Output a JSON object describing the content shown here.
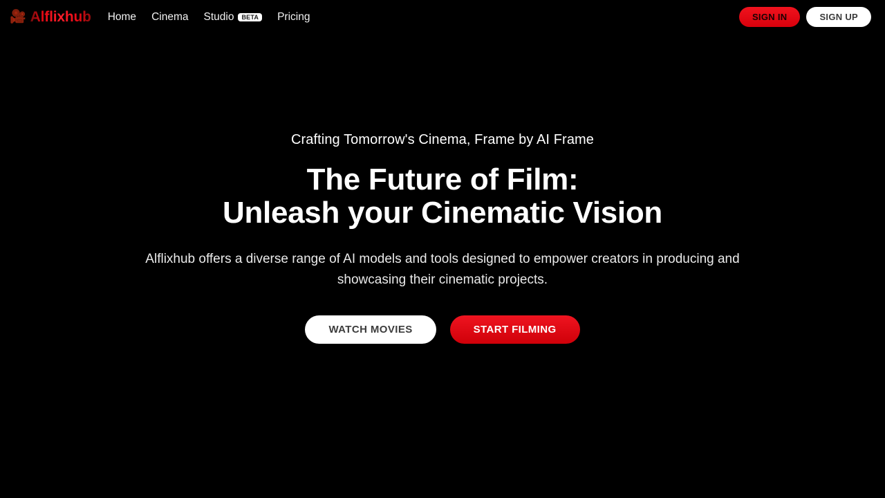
{
  "theme": {
    "background": "#000000",
    "brand_red": "#e60914",
    "text_primary": "#ffffff",
    "text_on_light": "#3c3c3c"
  },
  "header": {
    "brand": {
      "icon": "movie-camera-icon",
      "icon_glyph": "🎥",
      "name": "Alflixhub"
    },
    "nav": [
      {
        "label": "Home",
        "badge": null
      },
      {
        "label": "Cinema",
        "badge": null
      },
      {
        "label": "Studio",
        "badge": "BETA"
      },
      {
        "label": "Pricing",
        "badge": null
      }
    ],
    "auth": {
      "sign_in_label": "SIGN IN",
      "sign_up_label": "SIGN UP"
    }
  },
  "hero": {
    "eyebrow": "Crafting Tomorrow's Cinema, Frame by AI Frame",
    "title_line_1": "The Future of Film:",
    "title_line_2": "Unleash your Cinematic Vision",
    "description": "Alflixhub offers a diverse range of AI models and tools designed to empower creators in producing and showcasing their cinematic projects.",
    "primary_cta": "START FILMING",
    "secondary_cta": "WATCH MOVIES"
  }
}
